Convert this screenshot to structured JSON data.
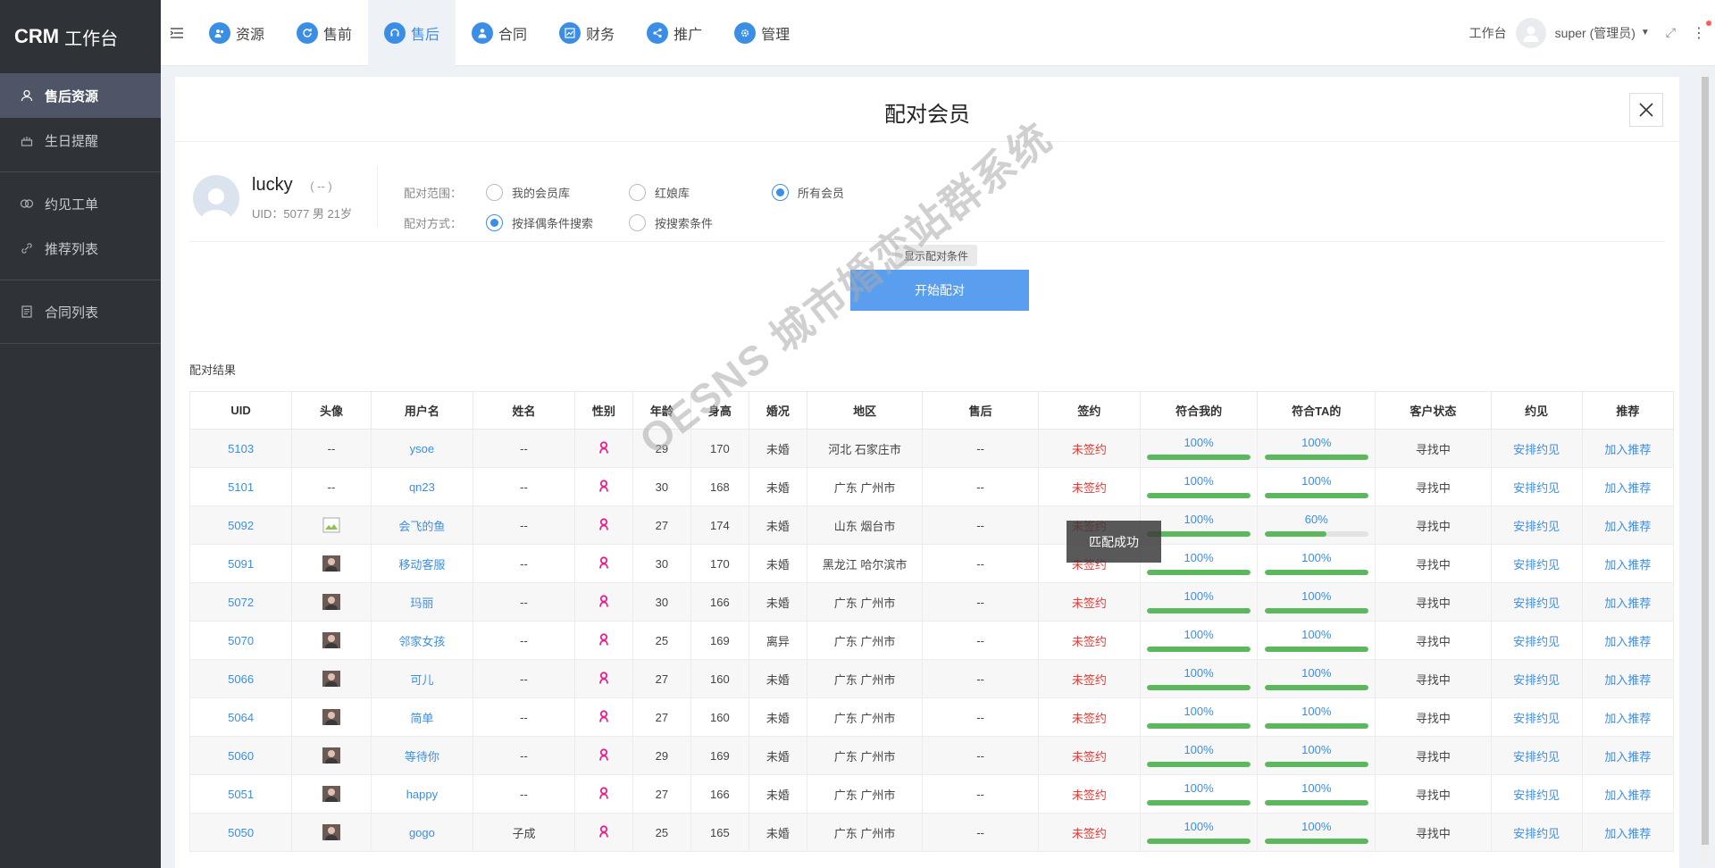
{
  "brand": {
    "name": "CRM",
    "sub": "工作台"
  },
  "sidebar": {
    "items": [
      {
        "label": "售后资源",
        "icon": "user-icon",
        "active": true
      },
      {
        "label": "生日提醒",
        "icon": "cake-icon",
        "active": false
      },
      {
        "label": "约见工单",
        "icon": "handshake-icon",
        "active": false
      },
      {
        "label": "推荐列表",
        "icon": "link-icon",
        "active": false
      },
      {
        "label": "合同列表",
        "icon": "document-icon",
        "active": false
      }
    ]
  },
  "topnav": {
    "tabs": [
      {
        "label": "资源",
        "icon": "users-icon",
        "active": false
      },
      {
        "label": "售前",
        "icon": "refresh-icon",
        "active": false
      },
      {
        "label": "售后",
        "icon": "headset-icon",
        "active": true
      },
      {
        "label": "合同",
        "icon": "person-icon",
        "active": false
      },
      {
        "label": "财务",
        "icon": "chart-icon",
        "active": false
      },
      {
        "label": "推广",
        "icon": "share-icon",
        "active": false
      },
      {
        "label": "管理",
        "icon": "gear-icon",
        "active": false
      }
    ],
    "workbench": "工作台",
    "user": "super (管理员)"
  },
  "panel": {
    "title": "配对会员",
    "member": {
      "name": "lucky",
      "tag": "( -- )",
      "uid_line": "UID：5077 男 21岁"
    },
    "scope": {
      "label": "配对范围：",
      "options": [
        "我的会员库",
        "红娘库",
        "所有会员"
      ],
      "selected": 2
    },
    "method": {
      "label": "配对方式：",
      "options": [
        "按择偶条件搜索",
        "按搜索条件"
      ],
      "selected": 0
    },
    "show_conditions": "显示配对条件",
    "start_button": "开始配对",
    "result_label": "配对结果",
    "toast": "匹配成功"
  },
  "table": {
    "headers": [
      "UID",
      "头像",
      "用户名",
      "姓名",
      "性别",
      "年龄",
      "身高",
      "婚况",
      "地区",
      "售后",
      "签约",
      "符合我的",
      "符合TA的",
      "客户状态",
      "约见",
      "推荐"
    ],
    "rows": [
      {
        "uid": "5103",
        "avatar": "--",
        "username": "ysoe",
        "name": "--",
        "age": "29",
        "height": "170",
        "marital": "未婚",
        "region": "河北 石家庄市",
        "aftersale": "--",
        "sign": "未签约",
        "match_me": 100,
        "match_me_text": "100%",
        "match_ta": 100,
        "match_ta_text": "100%",
        "status": "寻找中",
        "meet": "安排约见",
        "recommend": "加入推荐"
      },
      {
        "uid": "5101",
        "avatar": "--",
        "username": "qn23",
        "name": "--",
        "age": "30",
        "height": "168",
        "marital": "未婚",
        "region": "广东 广州市",
        "aftersale": "--",
        "sign": "未签约",
        "match_me": 100,
        "match_me_text": "100%",
        "match_ta": 100,
        "match_ta_text": "100%",
        "status": "寻找中",
        "meet": "安排约见",
        "recommend": "加入推荐"
      },
      {
        "uid": "5092",
        "avatar": "broken",
        "username": "会飞的鱼",
        "name": "--",
        "age": "27",
        "height": "174",
        "marital": "未婚",
        "region": "山东 烟台市",
        "aftersale": "--",
        "sign": "未签约",
        "match_me": 100,
        "match_me_text": "100%",
        "match_ta": 60,
        "match_ta_text": "60%",
        "status": "寻找中",
        "meet": "安排约见",
        "recommend": "加入推荐"
      },
      {
        "uid": "5091",
        "avatar": "photo",
        "username": "移动客服",
        "name": "--",
        "age": "30",
        "height": "170",
        "marital": "未婚",
        "region": "黑龙江 哈尔滨市",
        "aftersale": "--",
        "sign": "未签约",
        "match_me": 100,
        "match_me_text": "100%",
        "match_ta": 100,
        "match_ta_text": "100%",
        "status": "寻找中",
        "meet": "安排约见",
        "recommend": "加入推荐"
      },
      {
        "uid": "5072",
        "avatar": "photo",
        "username": "玛丽",
        "name": "--",
        "age": "30",
        "height": "166",
        "marital": "未婚",
        "region": "广东 广州市",
        "aftersale": "--",
        "sign": "未签约",
        "match_me": 100,
        "match_me_text": "100%",
        "match_ta": 100,
        "match_ta_text": "100%",
        "status": "寻找中",
        "meet": "安排约见",
        "recommend": "加入推荐"
      },
      {
        "uid": "5070",
        "avatar": "photo",
        "username": "邻家女孩",
        "name": "--",
        "age": "25",
        "height": "169",
        "marital": "离异",
        "region": "广东 广州市",
        "aftersale": "--",
        "sign": "未签约",
        "match_me": 100,
        "match_me_text": "100%",
        "match_ta": 100,
        "match_ta_text": "100%",
        "status": "寻找中",
        "meet": "安排约见",
        "recommend": "加入推荐"
      },
      {
        "uid": "5066",
        "avatar": "photo",
        "username": "可儿",
        "name": "--",
        "age": "27",
        "height": "160",
        "marital": "未婚",
        "region": "广东 广州市",
        "aftersale": "--",
        "sign": "未签约",
        "match_me": 100,
        "match_me_text": "100%",
        "match_ta": 100,
        "match_ta_text": "100%",
        "status": "寻找中",
        "meet": "安排约见",
        "recommend": "加入推荐"
      },
      {
        "uid": "5064",
        "avatar": "photo",
        "username": "简单",
        "name": "--",
        "age": "27",
        "height": "160",
        "marital": "未婚",
        "region": "广东 广州市",
        "aftersale": "--",
        "sign": "未签约",
        "match_me": 100,
        "match_me_text": "100%",
        "match_ta": 100,
        "match_ta_text": "100%",
        "status": "寻找中",
        "meet": "安排约见",
        "recommend": "加入推荐"
      },
      {
        "uid": "5060",
        "avatar": "photo",
        "username": "等待你",
        "name": "--",
        "age": "29",
        "height": "169",
        "marital": "未婚",
        "region": "广东 广州市",
        "aftersale": "--",
        "sign": "未签约",
        "match_me": 100,
        "match_me_text": "100%",
        "match_ta": 100,
        "match_ta_text": "100%",
        "status": "寻找中",
        "meet": "安排约见",
        "recommend": "加入推荐"
      },
      {
        "uid": "5051",
        "avatar": "photo",
        "username": "happy",
        "name": "--",
        "age": "27",
        "height": "166",
        "marital": "未婚",
        "region": "广东 广州市",
        "aftersale": "--",
        "sign": "未签约",
        "match_me": 100,
        "match_me_text": "100%",
        "match_ta": 100,
        "match_ta_text": "100%",
        "status": "寻找中",
        "meet": "安排约见",
        "recommend": "加入推荐"
      },
      {
        "uid": "5050",
        "avatar": "photo",
        "username": "gogo",
        "name": "子成",
        "age": "25",
        "height": "165",
        "marital": "未婚",
        "region": "广东 广州市",
        "aftersale": "--",
        "sign": "未签约",
        "match_me": 100,
        "match_me_text": "100%",
        "match_ta": 100,
        "match_ta_text": "100%",
        "status": "寻找中",
        "meet": "安排约见",
        "recommend": "加入推荐"
      }
    ]
  },
  "watermark": "OESNS 城市婚恋站群系统",
  "colors": {
    "accent": "#3b8ee6",
    "progress": "#5cb85c",
    "unsigned": "#e53935",
    "sex_female": "#e91e8c",
    "sidebar_bg": "#2f3237"
  }
}
